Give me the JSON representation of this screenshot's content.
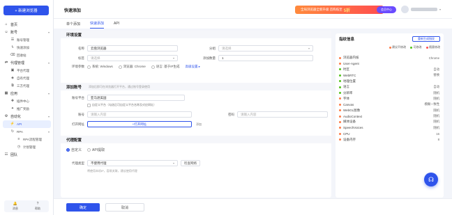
{
  "sidebar": {
    "new_browser_label": "+ 新建浏览器",
    "groups": [
      {
        "label": "首页",
        "icon": "home-icon"
      },
      {
        "label": "账号",
        "icon": "user-icon",
        "items": [
          {
            "label": "账号管理",
            "icon": "user-manage-icon"
          },
          {
            "label": "快速添加",
            "icon": "lightning-icon"
          },
          {
            "label": "回收站",
            "icon": "trash-icon"
          }
        ]
      },
      {
        "label": "代理管理",
        "icon": "proxy-icon",
        "items": [
          {
            "label": "平台代理",
            "icon": "platform-icon"
          },
          {
            "label": "自有代理",
            "icon": "own-proxy-icon"
          },
          {
            "label": "三方代理",
            "icon": "third-party-icon"
          }
        ]
      },
      {
        "label": "应用",
        "icon": "app-icon",
        "items": [
          {
            "label": "插件中心",
            "icon": "plugin-icon"
          },
          {
            "label": "推广奖励",
            "icon": "gift-icon"
          }
        ]
      },
      {
        "label": "自动化",
        "icon": "robot-icon",
        "items": [
          {
            "label": "API",
            "icon": "api-icon",
            "active": true
          },
          {
            "label": "RPA",
            "icon": "rpa-icon",
            "sub": [
              {
                "label": "RPA流程管理",
                "icon": "flow-icon"
              },
              {
                "label": "计划管理",
                "icon": "schedule-icon"
              }
            ]
          }
        ]
      },
      {
        "label": "团队",
        "icon": "team-icon"
      }
    ],
    "bottom": [
      {
        "label": "消息",
        "icon": "bell-icon"
      },
      {
        "label": "帮助",
        "icon": "help-icon"
      }
    ]
  },
  "header": {
    "title": "快速添加",
    "promo_text": "全局浏览器全新升级 首购低至",
    "promo_highlight": "5折",
    "vip_label": "会员中心"
  },
  "tabs": [
    {
      "label": "单个添加",
      "active": false
    },
    {
      "label": "快速添加",
      "active": true
    },
    {
      "label": "API",
      "active": false
    }
  ],
  "basic": {
    "section_title": "环境设置",
    "name_label": "名称",
    "name_value": "云盘浏览器",
    "group_label": "分组",
    "group_placeholder": "请选择",
    "tag_label": "标签",
    "tag_placeholder": "请选择",
    "count_label": "添加数量",
    "count_value": "1",
    "env_label": "环境参数",
    "env_options": [
      "系统: Windows",
      "浏览器: Chrome",
      "语言: 基于IP生成"
    ],
    "advanced_link": "高级设置 ▸"
  },
  "account": {
    "section_title": "添加账号",
    "hint": "添加后即可在浏览器打开平台，通过账号登录使用",
    "platform_label": "账号平台",
    "platform_value": "亚马逊美国",
    "custom_platform_label": "自定义平台（勾选后可自定义平台名称及对应网址）",
    "account_label": "账号",
    "account_placeholder": "请输入内容",
    "password_label": "密码",
    "password_placeholder": "请输入内容",
    "open_url_label": "打开网址",
    "open_url_button": "+打开网址",
    "open_url_add": "添加"
  },
  "proxy": {
    "section_title": "代理配置",
    "modes": [
      "自定义",
      "API提取"
    ],
    "type_label": "代理类型",
    "type_value": "不使用代理",
    "check_button": "检查网络",
    "hint": "将使用本机IP，容易关联，建议使用代理"
  },
  "footer": {
    "ok_label": "确定",
    "cancel_label": "取消"
  },
  "fingerprint": {
    "title": "指纹信息",
    "regen_button": "重新生成指纹",
    "legend": [
      {
        "label": "建议不修改",
        "color": "#ff7a45"
      },
      {
        "label": "可修改",
        "color": "#52c41a"
      },
      {
        "label": "随意修改",
        "color": "#ff4d4f"
      }
    ],
    "items": [
      {
        "label": "浏览器内核",
        "value": "Chrome",
        "color": "#ff7a45"
      },
      {
        "label": "User-Agent",
        "value": "",
        "color": "#ff7a45"
      },
      {
        "label": "时区",
        "value": "自动",
        "color": "#52c41a"
      },
      {
        "label": "WebRTC",
        "value": "替换",
        "color": "#52c41a"
      },
      {
        "label": "地理位置",
        "value": "",
        "color": "#52c41a"
      },
      {
        "label": "语言",
        "value": "自动",
        "color": "#52c41a"
      },
      {
        "label": "分辨率",
        "value": "随机",
        "color": "#52c41a"
      },
      {
        "label": "字体",
        "value": "随机",
        "color": "#ff7a45"
      },
      {
        "label": "Canvas",
        "value": "模糊一致性",
        "color": "#ff7a45"
      },
      {
        "label": "WebGL图像",
        "value": "随机",
        "color": "#ff7a45"
      },
      {
        "label": "AudioContext",
        "value": "随机",
        "color": "#ff7a45"
      },
      {
        "label": "媒体设备",
        "value": "随机",
        "color": "#ff7a45"
      },
      {
        "label": "SpeechVoices",
        "value": "随机",
        "color": "#ff7a45"
      },
      {
        "label": "CPU",
        "value": "16",
        "color": "#ff7a45"
      },
      {
        "label": "设备内存",
        "value": "8",
        "color": "#ff7a45"
      }
    ]
  }
}
